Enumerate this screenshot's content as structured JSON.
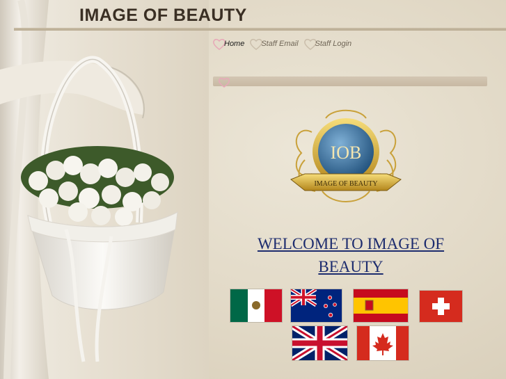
{
  "header": {
    "title": "IMAGE OF BEAUTY"
  },
  "nav": {
    "items": [
      {
        "label": "Home",
        "active": true
      },
      {
        "label": "Staff Email",
        "active": false
      },
      {
        "label": "Staff Login",
        "active": false
      }
    ]
  },
  "emblem": {
    "initials": "IOB",
    "banner_text": "IMAGE OF BEAUTY"
  },
  "welcome": {
    "line1": "WELCOME TO IMAGE OF",
    "line2": "BEAUTY"
  },
  "flags": [
    "mexico",
    "new-zealand",
    "spain",
    "switzerland",
    "united-kingdom",
    "canada"
  ],
  "colors": {
    "heading": "#1d2c6e",
    "title": "#3a2f24",
    "accent": "#e7a9b8"
  }
}
